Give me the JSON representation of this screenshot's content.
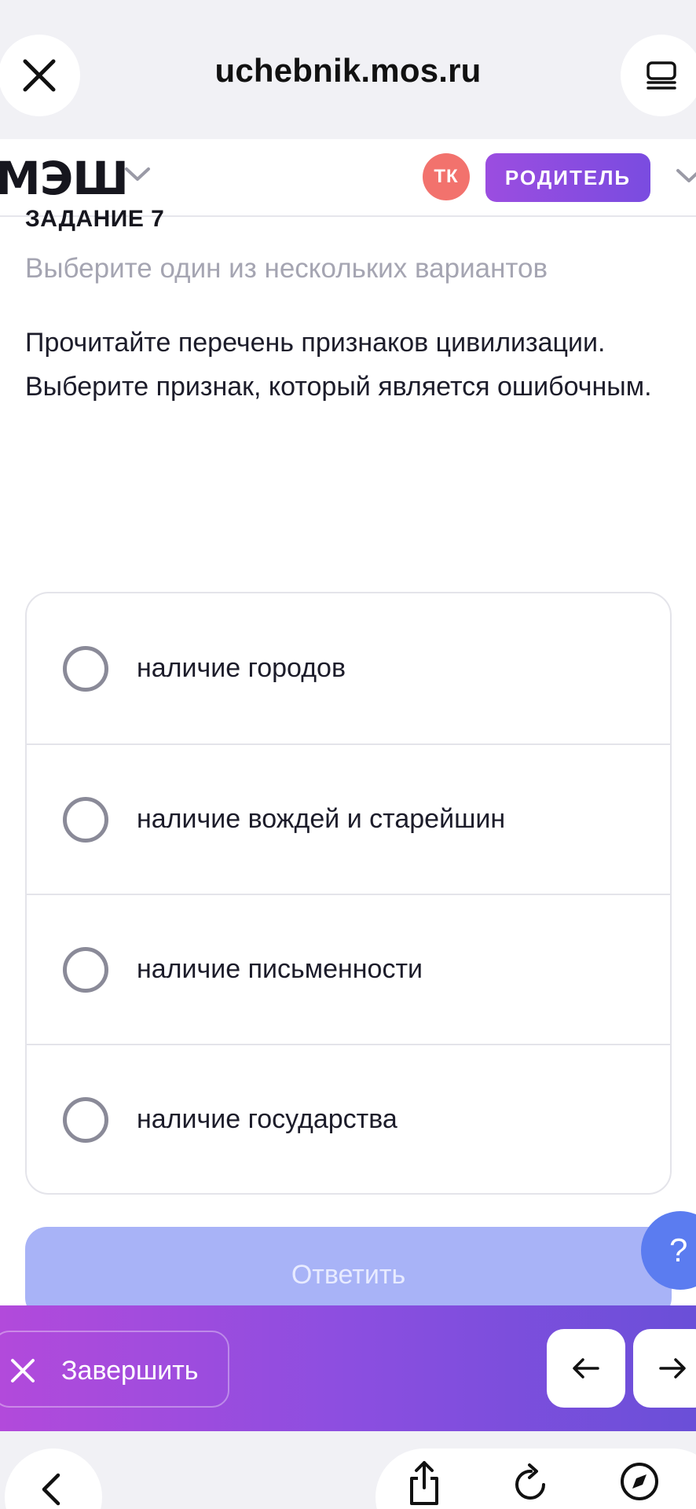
{
  "browser": {
    "url": "uchebnik.mos.ru"
  },
  "header": {
    "logo": "МЭШ",
    "avatar_initials": "ТК",
    "role_label": "РОДИТЕЛЬ"
  },
  "task": {
    "number_label": "ЗАДАНИЕ 7",
    "hint": "Выберите один из нескольких вариантов",
    "question": "Прочитайте перечень признаков цивилизации. Выберите признак, который является ошибочным.",
    "options": [
      {
        "label": "наличие городов",
        "selected": false
      },
      {
        "label": "наличие вождей и старейшин",
        "selected": false
      },
      {
        "label": "наличие письменности",
        "selected": false
      },
      {
        "label": "наличие государства",
        "selected": false
      }
    ],
    "answer_label": "Ответить",
    "help_label": "?"
  },
  "action_bar": {
    "finish_label": "Завершить"
  },
  "icons": {
    "close": "close-icon",
    "tabs": "tabs-icon",
    "chevron": "chevron-down-icon",
    "prev": "arrow-left-icon",
    "next": "arrow-right-icon",
    "back": "chevron-left-icon",
    "share": "share-icon",
    "reload": "reload-icon",
    "compass": "compass-icon"
  },
  "colors": {
    "brand_gradient_start": "#b24adb",
    "brand_gradient_end": "#6a4fd8",
    "avatar": "#f2726d",
    "answer_button": "#a8b3f7",
    "help_button": "#5b7cf0"
  }
}
